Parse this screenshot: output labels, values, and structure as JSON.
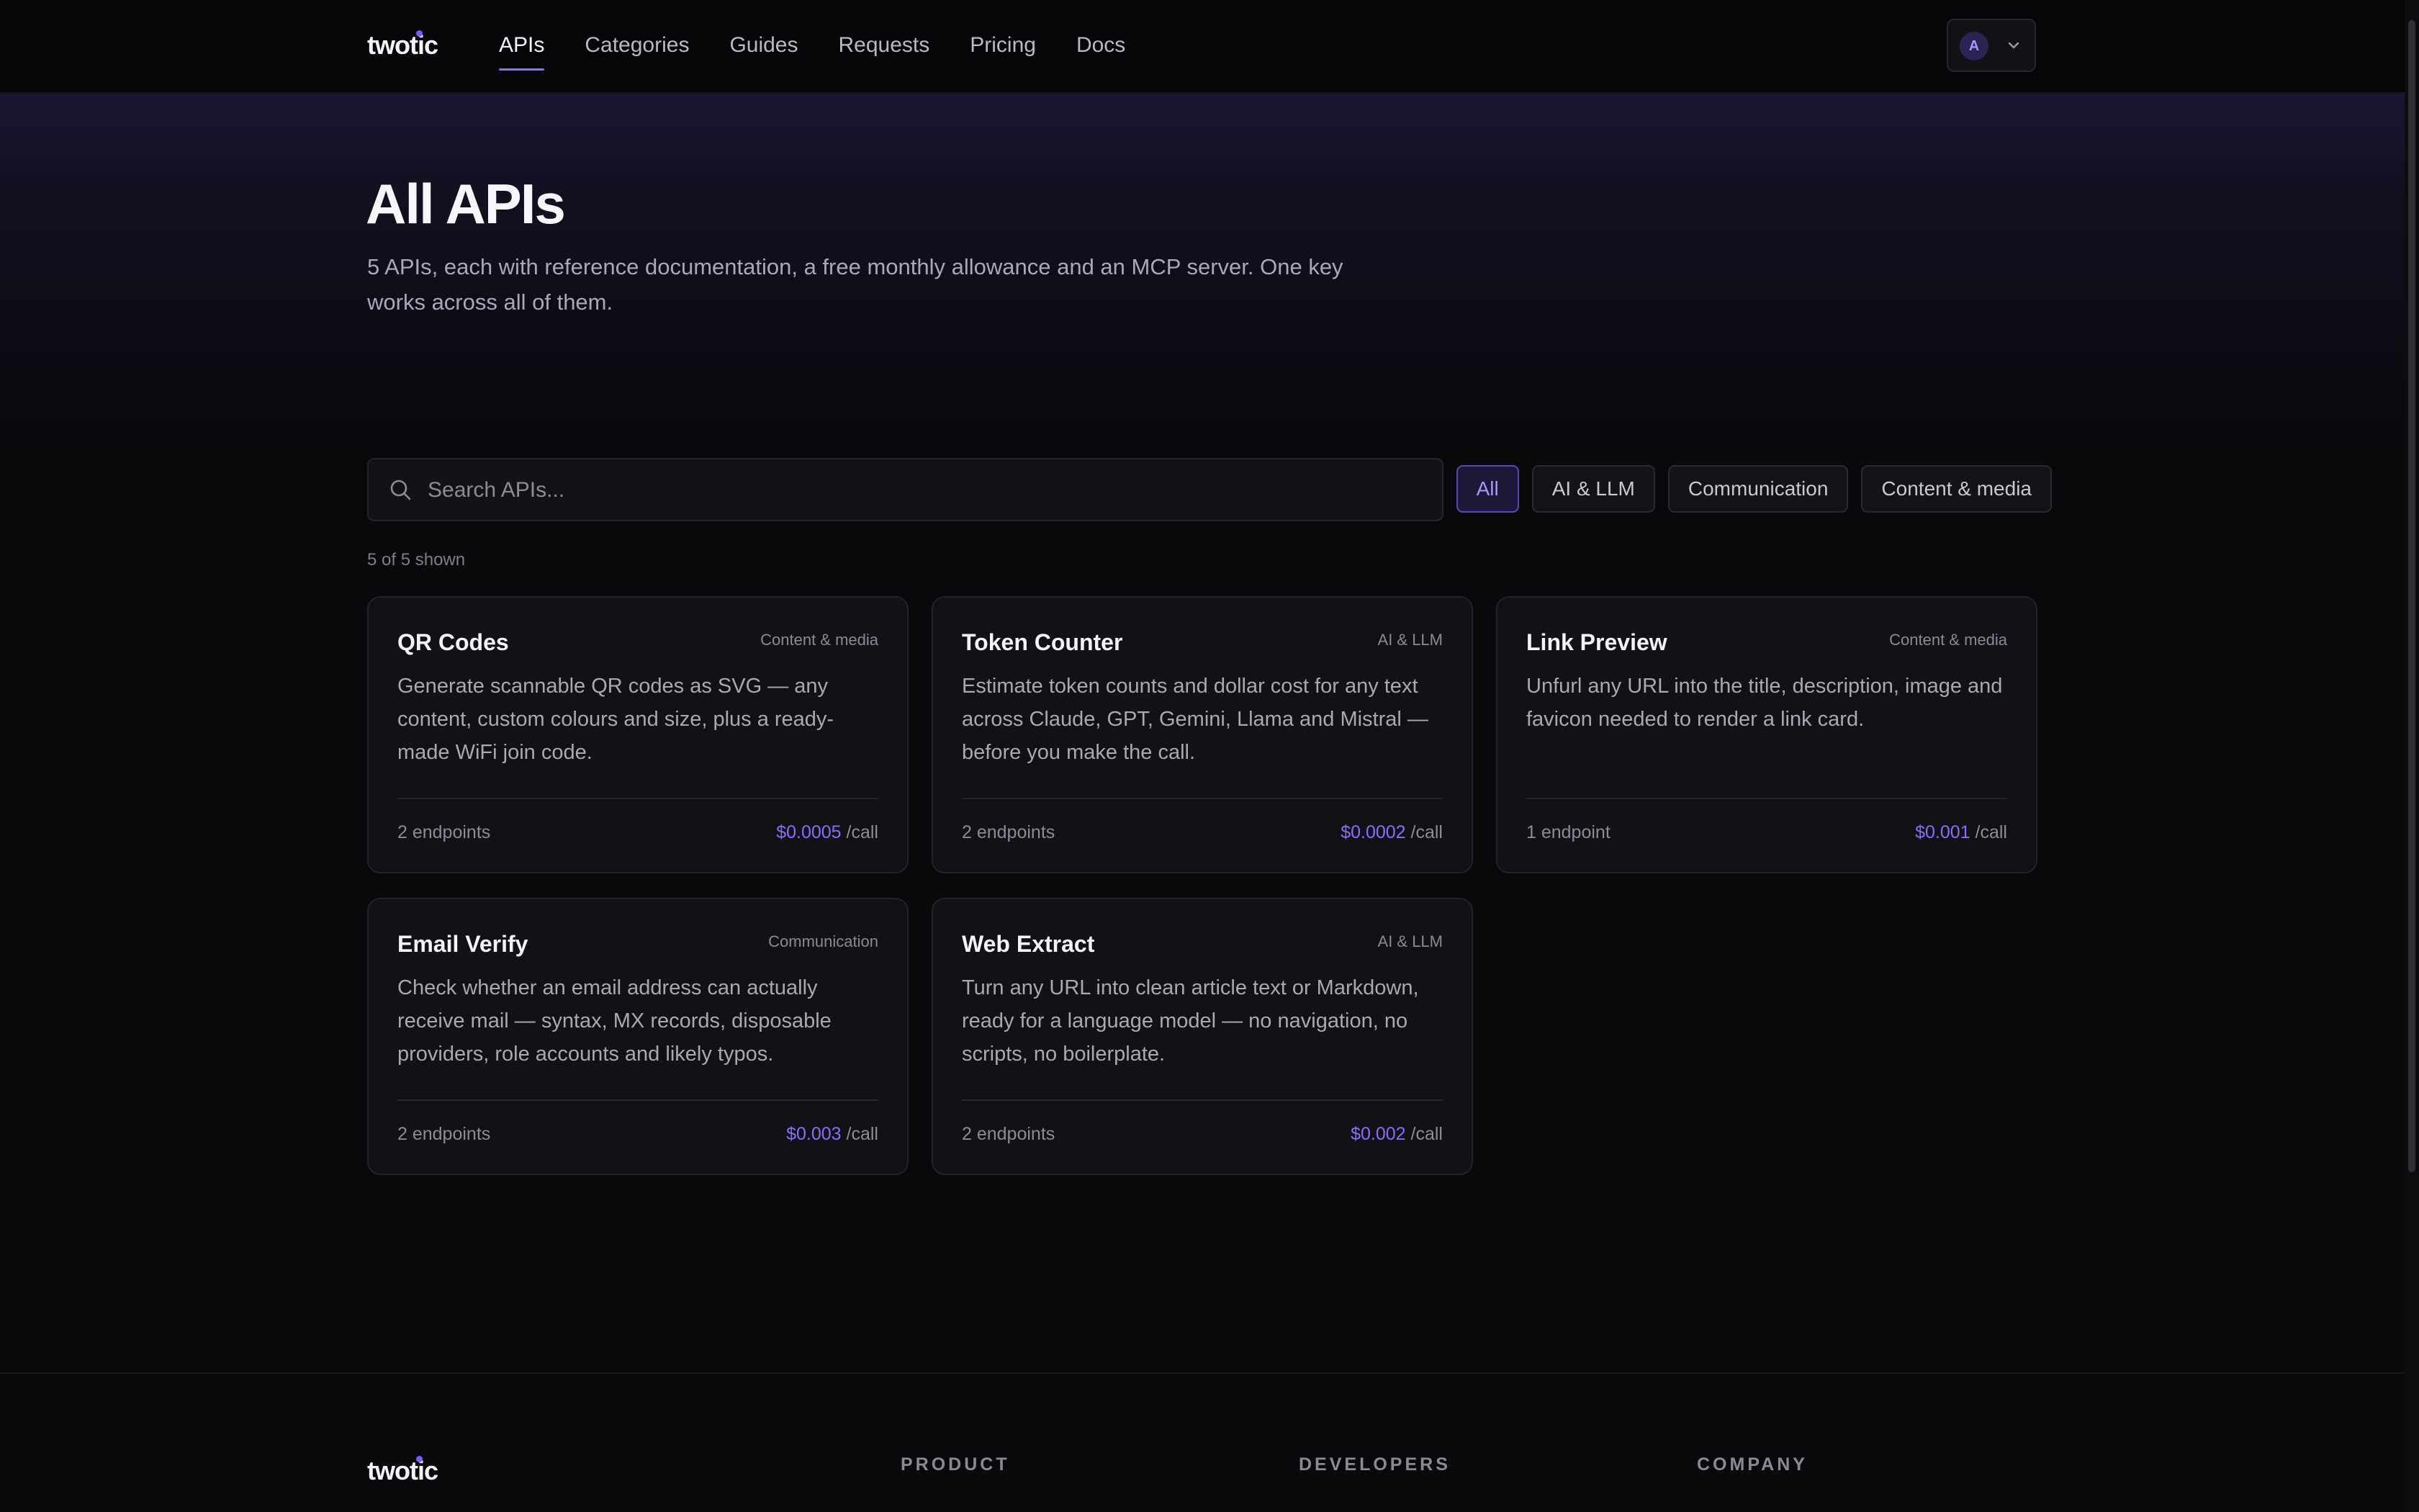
{
  "brand": "twotic",
  "nav": {
    "links": [
      {
        "label": "APIs",
        "active": true
      },
      {
        "label": "Categories"
      },
      {
        "label": "Guides"
      },
      {
        "label": "Requests"
      },
      {
        "label": "Pricing"
      },
      {
        "label": "Docs"
      }
    ],
    "avatar_initial": "A"
  },
  "hero": {
    "title": "All APIs",
    "subtitle": "5 APIs, each with reference documentation, a free monthly allowance and an MCP server. One key works across all of them."
  },
  "search": {
    "placeholder": "Search APIs..."
  },
  "filters": [
    {
      "label": "All",
      "active": true
    },
    {
      "label": "AI & LLM"
    },
    {
      "label": "Communication"
    },
    {
      "label": "Content & media"
    }
  ],
  "count_text": "5 of 5 shown",
  "cards": [
    {
      "name": "QR Codes",
      "category": "Content & media",
      "description": "Generate scannable QR codes as SVG — any content, custom colours and size, plus a ready-made WiFi join code.",
      "endpoints": "2 endpoints",
      "price": "$0.0005",
      "unit": "/call"
    },
    {
      "name": "Token Counter",
      "category": "AI & LLM",
      "description": "Estimate token counts and dollar cost for any text across Claude, GPT, Gemini, Llama and Mistral — before you make the call.",
      "endpoints": "2 endpoints",
      "price": "$0.0002",
      "unit": "/call"
    },
    {
      "name": "Link Preview",
      "category": "Content & media",
      "description": "Unfurl any URL into the title, description, image and favicon needed to render a link card.",
      "endpoints": "1 endpoint",
      "price": "$0.001",
      "unit": "/call"
    },
    {
      "name": "Email Verify",
      "category": "Communication",
      "description": "Check whether an email address can actually receive mail — syntax, MX records, disposable providers, role accounts and likely typos.",
      "endpoints": "2 endpoints",
      "price": "$0.003",
      "unit": "/call"
    },
    {
      "name": "Web Extract",
      "category": "AI & LLM",
      "description": "Turn any URL into clean article text or Markdown, ready for a language model — no navigation, no scripts, no boilerplate.",
      "endpoints": "2 endpoints",
      "price": "$0.002",
      "unit": "/call"
    }
  ],
  "footer": {
    "brand": "twotic",
    "columns": [
      "PRODUCT",
      "DEVELOPERS",
      "COMPANY"
    ]
  },
  "colors": {
    "accent": "#8b6cff",
    "background": "#09090c",
    "card": "#111116"
  }
}
